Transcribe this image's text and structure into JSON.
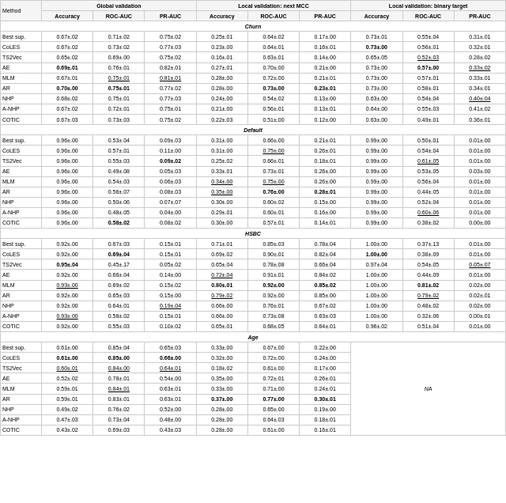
{
  "table": {
    "caption": "",
    "col_groups": [
      {
        "label": "Method",
        "span": 1
      },
      {
        "label": "Global validation",
        "span": 3
      },
      {
        "label": "Local validation: next MCC",
        "span": 3
      },
      {
        "label": "Local validation: binary target",
        "span": 3
      }
    ],
    "sub_headers": [
      "",
      "Accuracy",
      "ROC-AUC",
      "PR-AUC",
      "Accuracy",
      "ROC-AUC",
      "PR-AUC",
      "Accuracy",
      "ROC-AUC",
      "PR-AUC"
    ],
    "sections": [
      {
        "name": "Churn",
        "rows": [
          {
            "method": "Best sup.",
            "vals": [
              "0.67±.02",
              "0.71±.02",
              "0.75±.02",
              "0.25±.01",
              "0.64±.02",
              "0.17±.00",
              "0.73±.01",
              "0.55±.04",
              "0.31±.01"
            ],
            "bold": [],
            "underline": []
          },
          {
            "method": "CoLES",
            "vals": [
              "0.67±.02",
              "0.73±.02",
              "0.77±.03",
              "0.23±.00",
              "0.64±.01",
              "0.16±.01",
              "0.73±.00",
              "0.56±.01",
              "0.32±.01"
            ],
            "bold": [
              6
            ],
            "underline": []
          },
          {
            "method": "TS2Vec",
            "vals": [
              "0.65±.02",
              "0.69±.00",
              "0.75±.02",
              "0.16±.01",
              "0.63±.01",
              "0.14±.00",
              "0.65±.05",
              "0.52±.03",
              "0.28±.02"
            ],
            "bold": [],
            "underline": [
              7
            ]
          },
          {
            "method": "AE",
            "vals": [
              "0.69±.01",
              "0.76±.01",
              "0.82±.01",
              "0.27±.01",
              "0.70±.00",
              "0.21±.00",
              "0.73±.00",
              "0.57±.00",
              "0.33±.02"
            ],
            "bold": [
              1,
              7
            ],
            "underline": [
              8
            ]
          },
          {
            "method": "MLM",
            "vals": [
              "0.67±.01",
              "0.75±.01",
              "0.81±.01",
              "0.28±.00",
              "0.72±.00",
              "0.21±.01",
              "0.73±.00",
              "0.57±.01",
              "0.33±.01"
            ],
            "bold": [],
            "underline": [
              1,
              2
            ]
          },
          {
            "method": "AR",
            "vals": [
              "0.70±.00",
              "0.75±.01",
              "0.77±.02",
              "0.28±.00",
              "0.73±.00",
              "0.23±.01",
              "0.73±.00",
              "0.58±.01",
              "0.34±.01"
            ],
            "bold": [
              0,
              1,
              4,
              5
            ],
            "underline": []
          },
          {
            "method": "NHP",
            "vals": [
              "0.68±.02",
              "0.75±.01",
              "0.77±.03",
              "0.24±.00",
              "0.54±.02",
              "0.13±.00",
              "0.63±.00",
              "0.54±.04",
              "0.40±.04"
            ],
            "bold": [],
            "underline": [
              8
            ]
          },
          {
            "method": "A-NHP",
            "vals": [
              "0.67±.02",
              "0.72±.01",
              "0.75±.01",
              "0.21±.00",
              "0.56±.01",
              "0.13±.01",
              "0.64±.00",
              "0.55±.03",
              "0.41±.02"
            ],
            "bold": [],
            "underline": []
          },
          {
            "method": "COTIC",
            "vals": [
              "0.67±.03",
              "0.73±.03",
              "0.75±.02",
              "0.22±.03",
              "0.51±.00",
              "0.12±.00",
              "0.63±.00",
              "0.49±.01",
              "0.36±.01"
            ],
            "bold": [],
            "underline": []
          }
        ]
      },
      {
        "name": "Default",
        "rows": [
          {
            "method": "Best sup.",
            "vals": [
              "0.96±.00",
              "0.53±.04",
              "0.09±.03",
              "0.31±.00",
              "0.66±.00",
              "0.21±.01",
              "0.99±.00",
              "0.50±.01",
              "0.01±.00"
            ],
            "bold": [],
            "underline": []
          },
          {
            "method": "CoLES",
            "vals": [
              "0.96±.00",
              "0.57±.01",
              "0.11±.00",
              "0.31±.00",
              "0.75±.00",
              "0.26±.01",
              "0.99±.00",
              "0.54±.04",
              "0.01±.00"
            ],
            "bold": [],
            "underline": [
              4
            ]
          },
          {
            "method": "TS2Vec",
            "vals": [
              "0.96±.00",
              "0.55±.03",
              "0.09±.02",
              "0.25±.02",
              "0.66±.01",
              "0.18±.01",
              "0.99±.00",
              "0.61±.05",
              "0.01±.00"
            ],
            "bold": [
              2
            ],
            "underline": [
              7
            ]
          },
          {
            "method": "AE",
            "vals": [
              "0.96±.00",
              "0.49±.08",
              "0.05±.03",
              "0.33±.01",
              "0.73±.01",
              "0.26±.00",
              "0.99±.00",
              "0.53±.05",
              "0.03±.00"
            ],
            "bold": [],
            "underline": []
          },
          {
            "method": "MLM",
            "vals": [
              "0.96±.00",
              "0.54±.03",
              "0.06±.03",
              "0.34±.00",
              "0.75±.00",
              "0.26±.00",
              "0.99±.00",
              "0.56±.04",
              "0.01±.00"
            ],
            "bold": [],
            "underline": [
              3,
              4
            ]
          },
          {
            "method": "AR",
            "vals": [
              "0.96±.00",
              "0.56±.07",
              "0.08±.03",
              "0.35±.00",
              "0.76±.00",
              "0.28±.01",
              "0.99±.00",
              "0.44±.05",
              "0.01±.00"
            ],
            "bold": [
              4,
              5
            ],
            "underline": [
              3
            ]
          },
          {
            "method": "NHP",
            "vals": [
              "0.96±.00",
              "0.50±.06",
              "0.07±.07",
              "0.30±.00",
              "0.60±.02",
              "0.15±.00",
              "0.99±.00",
              "0.52±.04",
              "0.01±.00"
            ],
            "bold": [],
            "underline": []
          },
          {
            "method": "A-NHP",
            "vals": [
              "0.96±.00",
              "0.48±.05",
              "0.04±.00",
              "0.29±.01",
              "0.60±.01",
              "0.16±.00",
              "0.99±.00",
              "0.60±.06",
              "0.01±.00"
            ],
            "bold": [],
            "underline": [
              7
            ]
          },
          {
            "method": "COTIC",
            "vals": [
              "0.96±.00",
              "0.58±.02",
              "0.08±.02",
              "0.30±.00",
              "0.57±.01",
              "0.14±.01",
              "0.99±.00",
              "0.38±.02",
              "0.00±.00"
            ],
            "bold": [
              1
            ],
            "underline": []
          }
        ]
      },
      {
        "name": "HSBC",
        "rows": [
          {
            "method": "Best sup.",
            "vals": [
              "0.92±.00",
              "0.67±.03",
              "0.15±.01",
              "0.71±.01",
              "0.85±.03",
              "0.78±.04",
              "1.00±.00",
              "0.37±.13",
              "0.01±.00"
            ],
            "bold": [],
            "underline": []
          },
          {
            "method": "CoLES",
            "vals": [
              "0.92±.00",
              "0.69±.04",
              "0.15±.01",
              "0.69±.02",
              "0.90±.01",
              "0.82±.04",
              "1.00±.00",
              "0.38±.09",
              "0.01±.00"
            ],
            "bold": [
              1,
              6
            ],
            "underline": []
          },
          {
            "method": "TS2Vec",
            "vals": [
              "0.95±.04",
              "0.45±.17",
              "0.05±.02",
              "0.65±.04",
              "0.78±.08",
              "0.66±.04",
              "0.97±.04",
              "0.54±.05",
              "0.05±.07"
            ],
            "bold": [
              0
            ],
            "underline": [
              8
            ]
          },
          {
            "method": "AE",
            "vals": [
              "0.92±.00",
              "0.66±.04",
              "0.14±.00",
              "0.72±.04",
              "0.91±.01",
              "0.84±.02",
              "1.00±.00",
              "0.44±.09",
              "0.01±.00"
            ],
            "bold": [],
            "underline": [
              3
            ]
          },
          {
            "method": "MLM",
            "vals": [
              "0.93±.00",
              "0.69±.02",
              "0.15±.02",
              "0.80±.01",
              "0.92±.00",
              "0.85±.02",
              "1.00±.00",
              "0.81±.02",
              "0.02±.00"
            ],
            "bold": [
              3,
              4,
              5,
              7
            ],
            "underline": [
              0
            ]
          },
          {
            "method": "AR",
            "vals": [
              "0.92±.00",
              "0.65±.03",
              "0.15±.00",
              "0.79±.02",
              "0.92±.00",
              "0.85±.00",
              "1.00±.00",
              "0.79±.02",
              "0.02±.01"
            ],
            "bold": [],
            "underline": [
              3,
              7
            ]
          },
          {
            "method": "NHP",
            "vals": [
              "0.92±.00",
              "0.64±.01",
              "0.19±.04",
              "0.66±.00",
              "0.76±.01",
              "0.67±.02",
              "1.00±.00",
              "0.48±.02",
              "0.02±.00"
            ],
            "bold": [],
            "underline": [
              2
            ]
          },
          {
            "method": "A-NHP",
            "vals": [
              "0.93±.00",
              "0.58±.02",
              "0.15±.01",
              "0.66±.00",
              "0.73±.08",
              "0.63±.03",
              "1.00±.00",
              "0.32±.06",
              "0.00±.01"
            ],
            "bold": [],
            "underline": [
              0
            ]
          },
          {
            "method": "COTIC",
            "vals": [
              "0.92±.00",
              "0.55±.03",
              "0.10±.02",
              "0.65±.01",
              "0.68±.05",
              "0.64±.01",
              "0.96±.02",
              "0.51±.04",
              "0.01±.00"
            ],
            "bold": [],
            "underline": []
          }
        ]
      },
      {
        "name": "Age",
        "rows": [
          {
            "method": "Best sup.",
            "vals": [
              "0.61±.00",
              "0.85±.04",
              "0.65±.03",
              "0.33±.00",
              "0.67±.00",
              "0.22±.00",
              "",
              "",
              ""
            ],
            "bold": [],
            "underline": [],
            "na": true
          },
          {
            "method": "CoLES",
            "vals": [
              "0.61±.00",
              "0.85±.00",
              "0.66±.00",
              "0.32±.00",
              "0.72±.00",
              "0.24±.00",
              "",
              "",
              ""
            ],
            "bold": [
              0,
              1,
              2
            ],
            "underline": [],
            "na": true
          },
          {
            "method": "TS2Vec",
            "vals": [
              "0.60±.01",
              "0.84±.00",
              "0.64±.01",
              "0.18±.02",
              "0.61±.00",
              "0.17±.00",
              "",
              "",
              ""
            ],
            "bold": [],
            "underline": [
              0,
              1,
              2
            ],
            "na": true
          },
          {
            "method": "AE",
            "vals": [
              "0.52±.02",
              "0.78±.01",
              "0.54±.00",
              "0.35±.00",
              "0.72±.01",
              "0.26±.01",
              "",
              "",
              ""
            ],
            "bold": [],
            "underline": [],
            "na": true
          },
          {
            "method": "MLM",
            "vals": [
              "0.59±.01",
              "0.84±.01",
              "0.63±.01",
              "0.33±.00",
              "0.71±.00",
              "0.24±.01",
              "",
              "",
              ""
            ],
            "bold": [],
            "underline": [
              1
            ],
            "na": true
          },
          {
            "method": "AR",
            "vals": [
              "0.59±.01",
              "0.83±.01",
              "0.63±.01",
              "0.37±.00",
              "0.77±.00",
              "0.30±.01",
              "",
              "",
              ""
            ],
            "bold": [
              3,
              4,
              5
            ],
            "underline": [],
            "na": true
          },
          {
            "method": "NHP",
            "vals": [
              "0.49±.02",
              "0.76±.02",
              "0.52±.00",
              "0.28±.00",
              "0.65±.00",
              "0.19±.00",
              "",
              "",
              ""
            ],
            "bold": [],
            "underline": [],
            "na": true
          },
          {
            "method": "A-NHP",
            "vals": [
              "0.47±.03",
              "0.73±.04",
              "0.48±.00",
              "0.28±.00",
              "0.64±.03",
              "0.18±.01",
              "",
              "",
              ""
            ],
            "bold": [],
            "underline": [],
            "na": true
          },
          {
            "method": "COTIC",
            "vals": [
              "0.43±.02",
              "0.69±.03",
              "0.43±.03",
              "0.28±.00",
              "0.61±.00",
              "0.16±.01",
              "",
              "",
              ""
            ],
            "bold": [],
            "underline": [],
            "na": true
          }
        ],
        "na_label": "NA"
      }
    ]
  }
}
